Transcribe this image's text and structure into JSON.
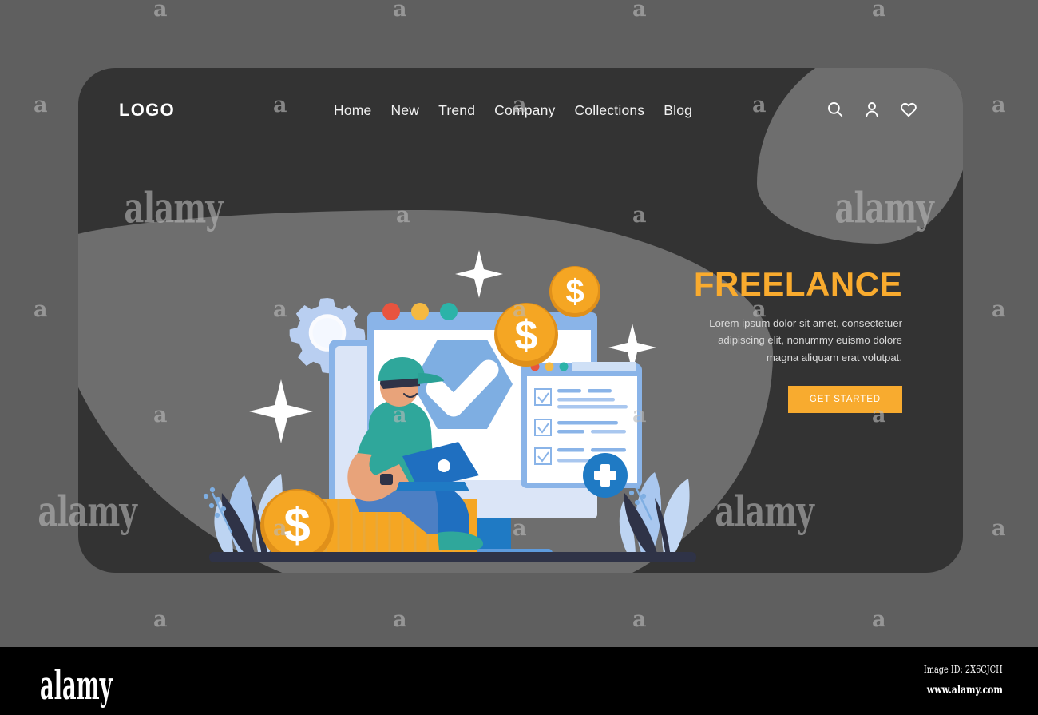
{
  "page": {
    "background_color": "#5f5f5f",
    "card_color": "#333333",
    "blob_color": "#6e6e6e",
    "accent_color": "#f9ab2e"
  },
  "nav": {
    "logo": "LOGO",
    "items": [
      {
        "label": "Home"
      },
      {
        "label": "New"
      },
      {
        "label": "Trend"
      },
      {
        "label": "Company"
      },
      {
        "label": "Collections"
      },
      {
        "label": "Blog"
      }
    ],
    "icons": [
      {
        "name": "search-icon"
      },
      {
        "name": "user-icon"
      },
      {
        "name": "heart-icon"
      }
    ]
  },
  "hero": {
    "title": "FREELANCE",
    "subtitle": "Lorem ipsum dolor sit amet, consectetuer adipiscing elit, nonummy euismo dolore magna aliquam erat volutpat.",
    "cta_label": "GET STARTED",
    "cta_color": "#f8ab2f",
    "title_color": "#f9ab2e"
  },
  "illustration": {
    "description": "Freelance hero illustration: monitor with shield checkmark, checklist card, gold dollar coins, gear, sparkles, person with laptop sitting on stack of coins, plants",
    "colors": {
      "screen_white": "#ffffff",
      "screen_frame": "#8ab4e8",
      "screen_light": "#dbe5f7",
      "shield_blue": "#7eaee2",
      "coin_gold": "#f5a623",
      "coin_gold_dark": "#e0901a",
      "person_shirt": "#2fa79b",
      "person_pants": "#4c7fc4",
      "ground_dark": "#2f3347",
      "plant_blue": "#a9c7ef",
      "dot_red": "#e8543f",
      "dot_yellow": "#f5b942",
      "dot_teal": "#2bb3a8",
      "plus_blue": "#1f7ac4"
    },
    "checklist_rows": 3,
    "window_dots": 3
  },
  "watermark": {
    "letter": "a",
    "word": "alamy",
    "color": "#b9b9b9"
  },
  "footer": {
    "logo": "alamy",
    "image_id": "Image ID: 2X6CJCH",
    "url": "www.alamy.com"
  }
}
